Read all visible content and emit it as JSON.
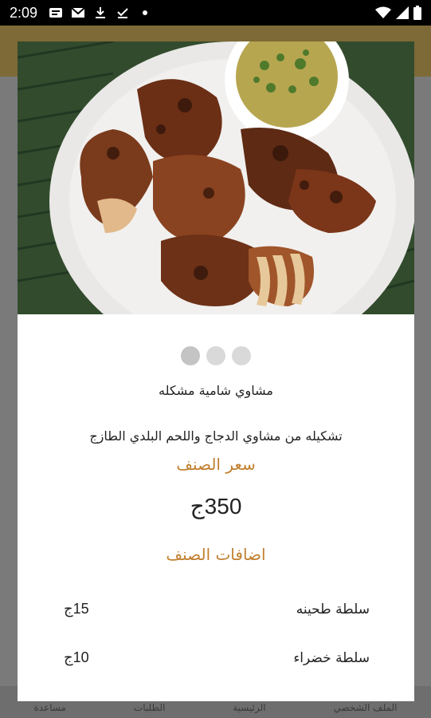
{
  "status_bar": {
    "time": "2:09"
  },
  "background_nav": {
    "items": [
      "الملف الشخصي",
      "الرئيسية",
      "الطلبات",
      "مساعدة"
    ]
  },
  "dialog": {
    "item_name": "مشاوي شامية مشكله",
    "description": "تشكيله من مشاوي الدجاج واللحم البلدي الطازج",
    "price_title": "سعر الصنف",
    "price": "350ج",
    "additions_title": "اضافات الصنف",
    "image_pager": {
      "count": 3,
      "active": 0
    },
    "addons": [
      {
        "name": "سلطة طحينه",
        "price": "15ج"
      },
      {
        "name": "سلطة خضراء",
        "price": "10ج"
      }
    ]
  },
  "colors": {
    "accent": "#c17f2e",
    "dot": "#d9d9d9"
  }
}
